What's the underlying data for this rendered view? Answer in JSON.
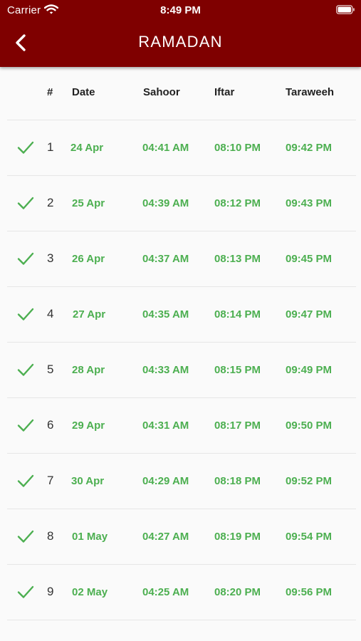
{
  "status_bar": {
    "carrier": "Carrier",
    "time": "8:49 PM"
  },
  "header": {
    "title": "RAMADAN",
    "back_icon": "chevron-left-icon"
  },
  "colors": {
    "header_bg": "#7f0000",
    "accent_green": "#4caf50"
  },
  "table": {
    "columns": {
      "num": "#",
      "date": "Date",
      "sahoor": "Sahoor",
      "iftar": "Iftar",
      "taraweeh": "Taraweeh"
    },
    "rows": [
      {
        "num": "1",
        "date": "24 Apr",
        "sahoor": "04:41 AM",
        "iftar": "08:10 PM",
        "taraweeh": "09:42 PM",
        "done": true
      },
      {
        "num": "2",
        "date": "25 Apr",
        "sahoor": "04:39 AM",
        "iftar": "08:12 PM",
        "taraweeh": "09:43 PM",
        "done": true
      },
      {
        "num": "3",
        "date": "26 Apr",
        "sahoor": "04:37 AM",
        "iftar": "08:13 PM",
        "taraweeh": "09:45 PM",
        "done": true
      },
      {
        "num": "4",
        "date": "27 Apr",
        "sahoor": "04:35 AM",
        "iftar": "08:14 PM",
        "taraweeh": "09:47 PM",
        "done": true
      },
      {
        "num": "5",
        "date": "28 Apr",
        "sahoor": "04:33 AM",
        "iftar": "08:15 PM",
        "taraweeh": "09:49 PM",
        "done": true
      },
      {
        "num": "6",
        "date": "29 Apr",
        "sahoor": "04:31 AM",
        "iftar": "08:17 PM",
        "taraweeh": "09:50 PM",
        "done": true
      },
      {
        "num": "7",
        "date": "30 Apr",
        "sahoor": "04:29 AM",
        "iftar": "08:18 PM",
        "taraweeh": "09:52 PM",
        "done": true
      },
      {
        "num": "8",
        "date": "01 May",
        "sahoor": "04:27 AM",
        "iftar": "08:19 PM",
        "taraweeh": "09:54 PM",
        "done": true
      },
      {
        "num": "9",
        "date": "02 May",
        "sahoor": "04:25 AM",
        "iftar": "08:20 PM",
        "taraweeh": "09:56 PM",
        "done": true
      }
    ]
  }
}
